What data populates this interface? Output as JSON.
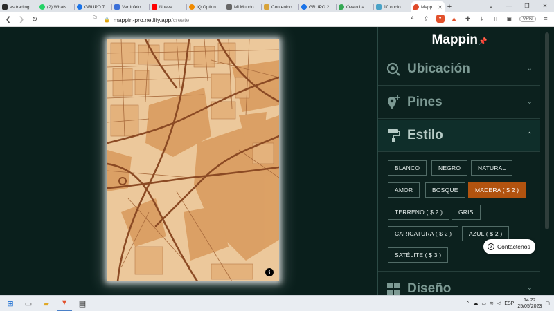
{
  "browser": {
    "tabs": [
      {
        "label": "es.trading",
        "color": "#2b2b2b"
      },
      {
        "label": "(2) Whats",
        "color": "#25d366"
      },
      {
        "label": "GRUPO 7",
        "color": "#1a73e8"
      },
      {
        "label": "Ver Infelo",
        "color": "#3b6fd8"
      },
      {
        "label": "Nueve",
        "color": "#ff0000"
      },
      {
        "label": "IQ Option",
        "color": "#f08a00"
      },
      {
        "label": "Mi Mundo",
        "color": "#666666"
      },
      {
        "label": "Contenido",
        "color": "#d8a33a"
      },
      {
        "label": "GRUPO 2",
        "color": "#1a73e8"
      },
      {
        "label": "Óvalo La",
        "color": "#34a853"
      },
      {
        "label": "10 opcio",
        "color": "#4aa3c8"
      },
      {
        "label": "Mapp",
        "color": "#e04a2a"
      }
    ],
    "new_tab": "+",
    "url_host": "mappin-pro.netlify.app",
    "url_path": "/create",
    "vpn": "VPN",
    "brave_badge": "1"
  },
  "app": {
    "brand": "Mappin",
    "sections": {
      "ubicacion": "Ubicación",
      "pines": "Pines",
      "estilo": "Estilo",
      "diseno": "Diseño"
    },
    "style_options": [
      "BLANCO",
      "NEGRO",
      "NATURAL",
      "AMOR",
      "BOSQUE",
      "MADERA ( $ 2 )",
      "TERRENO ( $ 2 )",
      "GRIS",
      "CARICATURA ( $ 2 )",
      "AZUL ( $ 2 )",
      "SATÉLITE ( $ 3 )"
    ],
    "selected_style": "MADERA ( $ 2 )",
    "contact_label": "Contáctenos",
    "info_glyph": "i"
  },
  "colors": {
    "accent": "#b2530f",
    "panel_bg": "#0c211e",
    "map_land": "#e8c193",
    "map_block": "#d99a5c",
    "map_road": "#8b4a24"
  },
  "taskbar": {
    "time": "14:22",
    "date": "25/05/2023",
    "lang": "ESP"
  }
}
